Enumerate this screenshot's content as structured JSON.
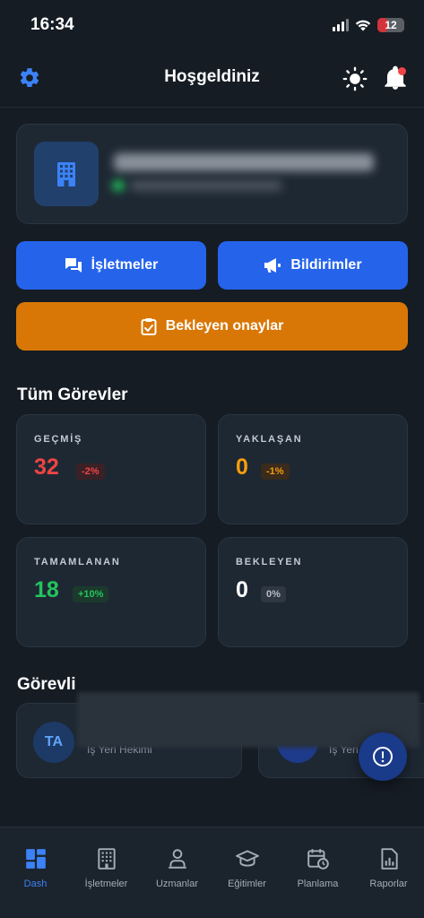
{
  "status_bar": {
    "time": "16:34",
    "battery": "12"
  },
  "header": {
    "title": "Hoşgeldiniz"
  },
  "actions": {
    "businesses_label": "İşletmeler",
    "notifications_label": "Bildirimler",
    "pending_label": "Bekleyen onaylar"
  },
  "tasks": {
    "title": "Tüm Görevler",
    "cards": [
      {
        "label": "GEÇMİŞ",
        "value": "32",
        "change": "-2%",
        "color": "#ef4444"
      },
      {
        "label": "YAKLAŞAN",
        "value": "0",
        "change": "-1%",
        "color": "#f59e0b"
      },
      {
        "label": "TAMAMLANAN",
        "value": "18",
        "change": "+10%",
        "color": "#22c55e"
      },
      {
        "label": "BEKLEYEN",
        "value": "0",
        "change": "0%",
        "color": "#ffffff"
      }
    ]
  },
  "technicians": {
    "title_visible": "Görevli",
    "items": [
      {
        "initials": "TA",
        "role": "İş Yeri Hekimi"
      },
      {
        "initials": "",
        "role": "İş Yeri"
      }
    ]
  },
  "tabs": [
    {
      "label": "Dash",
      "icon": "dashboard-icon",
      "active": true
    },
    {
      "label": "İşletmeler",
      "icon": "building-icon",
      "active": false
    },
    {
      "label": "Uzmanlar",
      "icon": "person-pin-icon",
      "active": false
    },
    {
      "label": "Eğitimler",
      "icon": "graduation-cap-icon",
      "active": false
    },
    {
      "label": "Planlama",
      "icon": "calendar-clock-icon",
      "active": false
    },
    {
      "label": "Raporlar",
      "icon": "report-icon",
      "active": false
    }
  ],
  "colors": {
    "background": "#151c24",
    "card": "#1e2833",
    "accent_blue": "#2563eb",
    "accent_orange": "#d97706"
  }
}
